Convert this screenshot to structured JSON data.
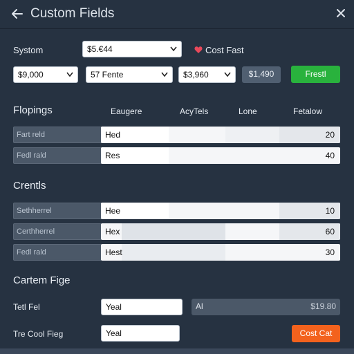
{
  "window": {
    "title": "Custom Fields"
  },
  "icons": {
    "back": "arrow-left-icon",
    "close": "close-icon",
    "heart": "heart-icon",
    "chevron": "chevron-down-icon"
  },
  "colors": {
    "background": "#263241",
    "accent_green": "#29b23d",
    "accent_orange": "#f3621d",
    "heart": "#e8495b"
  },
  "top": {
    "system_label": "Systom",
    "system_select_value": "$5.€44",
    "cost_label": "Cost Fast",
    "selects": [
      "$9,000",
      "57 Fente",
      "$3,960"
    ],
    "value_badge": "$1,490",
    "green_button": "Frestl"
  },
  "flopings": {
    "title": "Flopings",
    "columns": [
      "Eaugere",
      "AcyTels",
      "Lone",
      "Fetalow"
    ],
    "rows": [
      {
        "label": "Fart reld",
        "value": "Hed",
        "number": "20"
      },
      {
        "label": "Fedl rald",
        "value": "Res",
        "number": "40"
      }
    ]
  },
  "crentls": {
    "title": "Crentls",
    "rows": [
      {
        "label": "Sethherrel",
        "value": "Hee",
        "number": "10"
      },
      {
        "label": "Certhherrel",
        "value": "Hex",
        "number": "60"
      },
      {
        "label": "Fedl rald",
        "value": "Hest",
        "number": "30"
      }
    ]
  },
  "cartem": {
    "title": "Cartem Fige",
    "row1": {
      "label": "Tetl Fel",
      "value": "Yeal",
      "all_label": "Al",
      "all_amount": "$19.80"
    },
    "row2": {
      "label": "Tre Cool Fieg",
      "value": "Yeal",
      "button": "Cost Cat"
    }
  }
}
